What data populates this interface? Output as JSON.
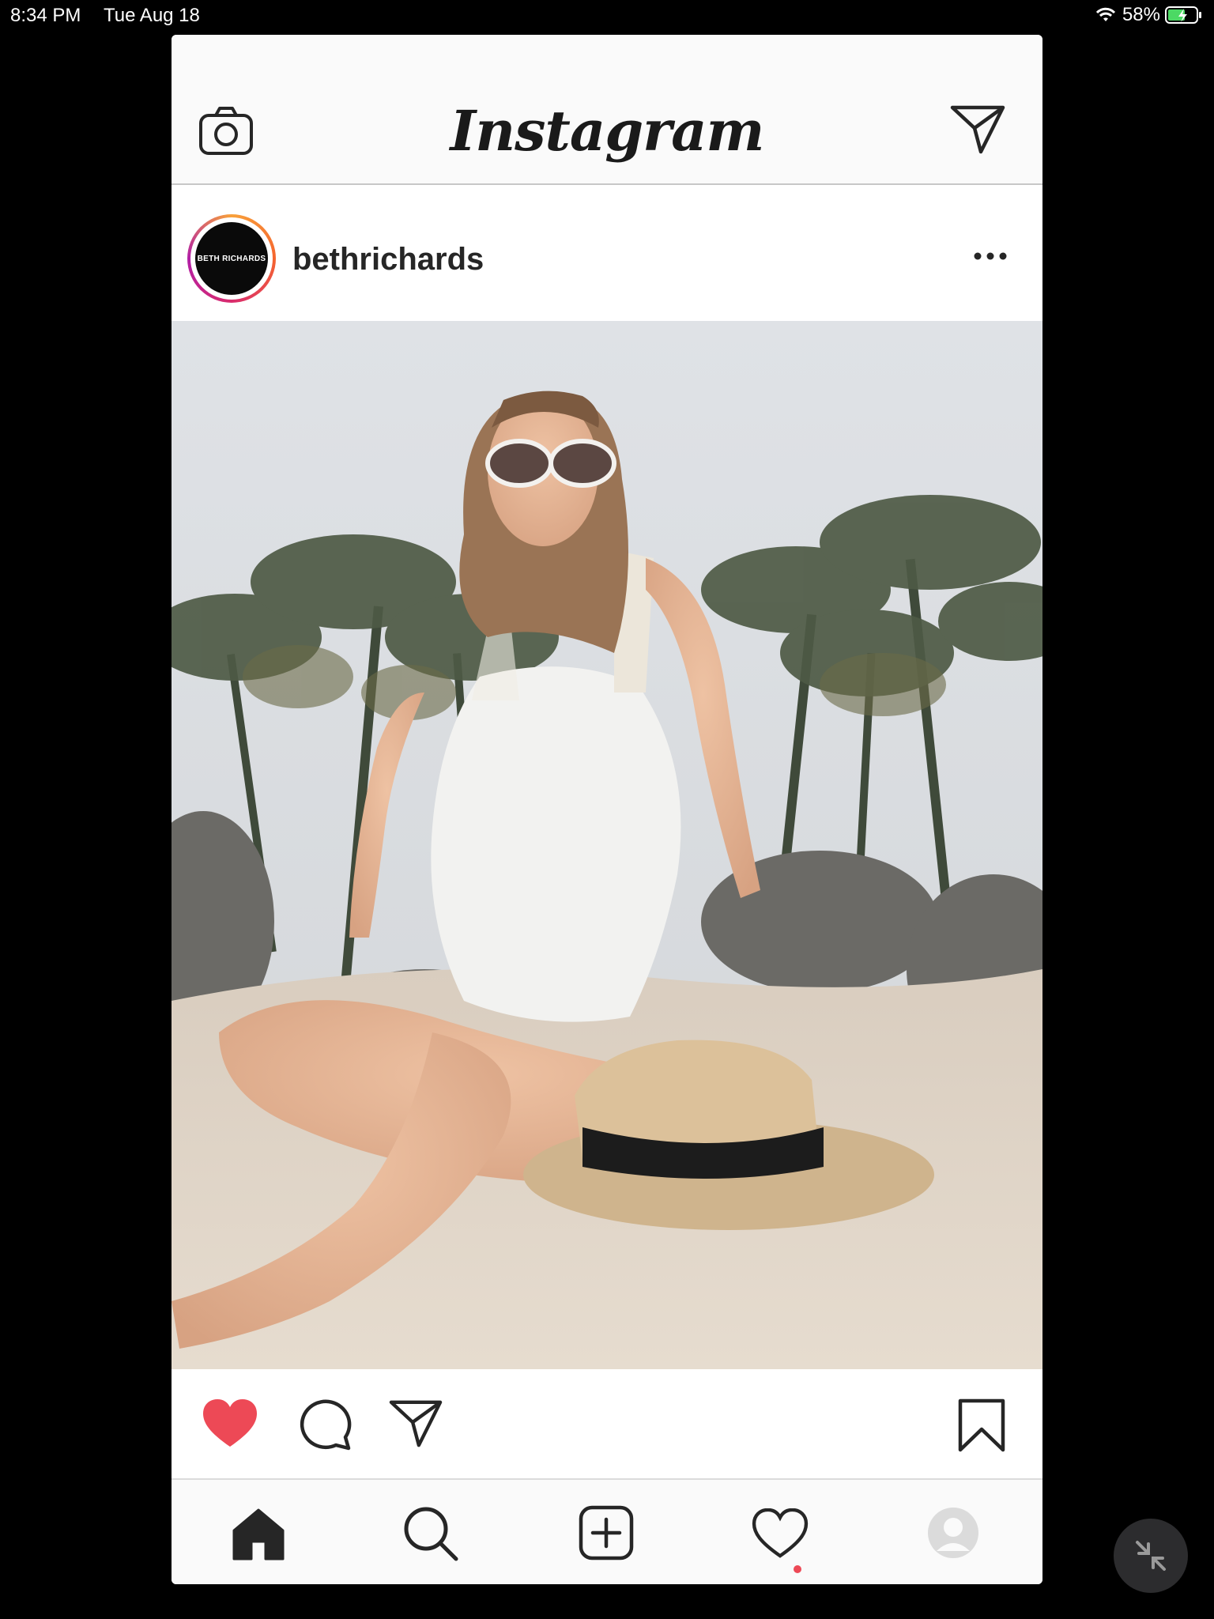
{
  "status_bar": {
    "time": "8:34 PM",
    "date": "Tue Aug 18",
    "battery_percent": "58%",
    "battery_level": 0.58,
    "wifi_icon": "wifi-icon",
    "battery_icon": "battery-charging-icon"
  },
  "app": {
    "title": "Instagram",
    "left_icon": "camera-icon",
    "right_icon": "direct-message-icon"
  },
  "post": {
    "username": "bethrichards",
    "avatar_text": "BETH RICHARDS",
    "more_icon": "more-options-icon",
    "photo_alt": "photo",
    "liked": true,
    "actions": {
      "like_icon": "heart-filled-icon",
      "comment_icon": "comment-icon",
      "share_icon": "share-icon",
      "save_icon": "bookmark-icon"
    }
  },
  "tab_bar": {
    "items": [
      {
        "name": "home",
        "icon": "home-filled-icon",
        "active": true
      },
      {
        "name": "search",
        "icon": "search-icon",
        "active": false
      },
      {
        "name": "new-post",
        "icon": "add-post-icon",
        "active": false
      },
      {
        "name": "activity",
        "icon": "heart-outline-icon",
        "active": false
      },
      {
        "name": "profile",
        "icon": "profile-avatar-icon",
        "active": false,
        "notification_dot": true
      }
    ]
  },
  "colors": {
    "like_red": "#ed4956",
    "icon_dark": "#262626",
    "background": "#000000"
  },
  "overlay": {
    "pip_icon": "collapse-arrows-icon"
  }
}
